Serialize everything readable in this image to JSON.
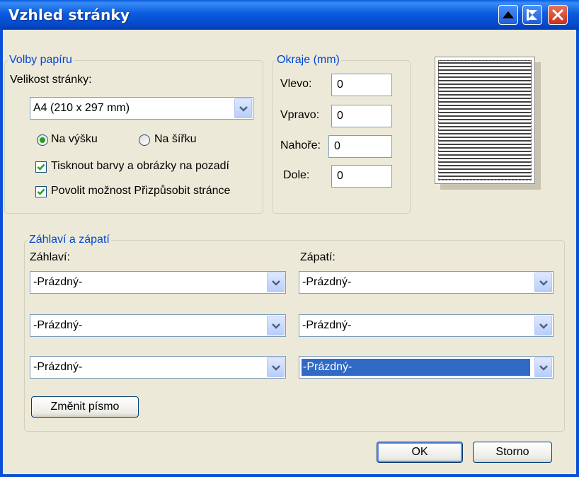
{
  "window": {
    "title": "Vzhled stránky"
  },
  "paper": {
    "legend": "Volby papíru",
    "size_label": "Velikost stránky:",
    "size_value": "A4 (210 x 297 mm)",
    "portrait_label": "Na výšku",
    "landscape_label": "Na šířku",
    "orientation_selected": "Na výšku",
    "print_background_label": "Tisknout barvy a obrázky na pozadí",
    "print_background_checked": true,
    "shrink_to_fit_label": "Povolit možnost Přizpůsobit stránce",
    "shrink_to_fit_checked": true
  },
  "margins": {
    "legend": "Okraje (mm)",
    "left_label": "Vlevo:",
    "left_value": "0",
    "right_label": "Vpravo:",
    "right_value": "0",
    "top_label": "Nahoře:",
    "top_value": "0",
    "bottom_label": "Dole:",
    "bottom_value": "0"
  },
  "header_footer": {
    "legend": "Záhlaví a zápatí",
    "header_label": "Záhlaví:",
    "footer_label": "Zápatí:",
    "header_values": [
      "-Prázdný-",
      "-Prázdný-",
      "-Prázdný-"
    ],
    "footer_values": [
      "-Prázdný-",
      "-Prázdný-",
      "-Prázdný-"
    ],
    "change_font_label": "Změnit písmo"
  },
  "buttons": {
    "ok": "OK",
    "cancel": "Storno"
  },
  "colors": {
    "titlebar": "#0a5be0",
    "dialog_bg": "#ece9d8",
    "group_legend": "#0046d5",
    "selection": "#316ac5",
    "close_button": "#c8321c"
  }
}
